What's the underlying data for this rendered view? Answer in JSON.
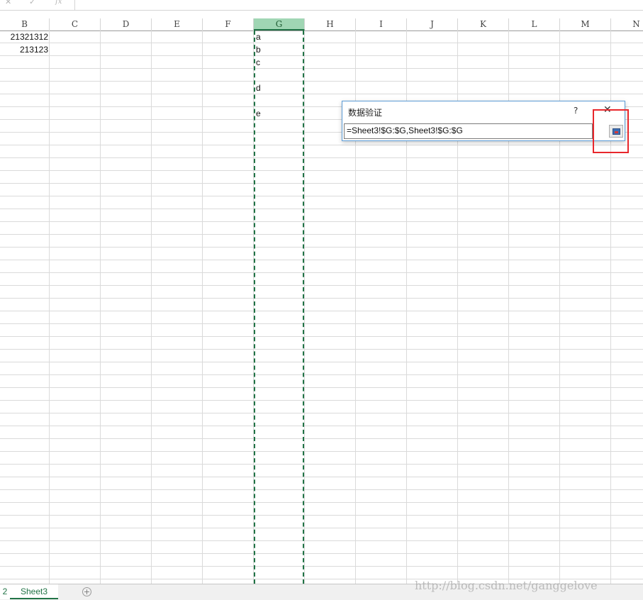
{
  "formula_bar": {
    "cancel_glyph": "✕",
    "enter_glyph": "✓",
    "fx_label": "fx"
  },
  "columns": [
    "B",
    "C",
    "D",
    "E",
    "F",
    "G",
    "H",
    "I",
    "J",
    "K",
    "L",
    "M",
    "N"
  ],
  "selected_column": "G",
  "cells": {
    "B1": "21321312",
    "B2": "213123",
    "G1": "a",
    "G2": "b",
    "G3": "c",
    "G5": "d",
    "G7": "e"
  },
  "dialog": {
    "title": "数据验证",
    "help": "?",
    "close": "✕",
    "input_value": "=Sheet3!$G:$G,Sheet3!$G:$G",
    "collapse_icon": "range-collapse-icon"
  },
  "sheet_tabs": {
    "prev_tab_partial": "2",
    "active_tab": "Sheet3",
    "add_glyph": "+"
  },
  "watermark": "http://blog.csdn.net/ganggelove",
  "colors": {
    "accent": "#217346",
    "header_selected": "#a0d6b4",
    "highlight": "#e8272c",
    "dialog_border": "#5b9bd5"
  }
}
